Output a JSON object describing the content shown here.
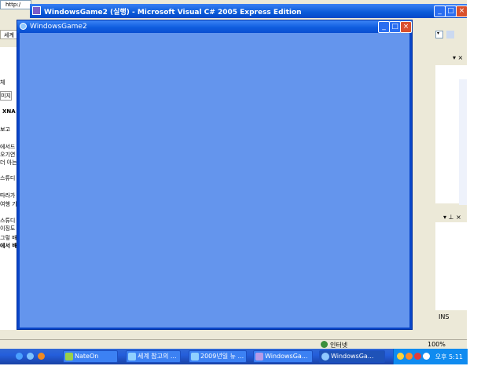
{
  "ie": {
    "address_label": "http:/",
    "tab_label": "세계",
    "left_texts": [
      "체",
      "미지",
      "XNA",
      "보고",
      "에서드",
      "오기연",
      "더 아는",
      "스튜디",
      "따라가",
      "여행 기",
      "스튜디",
      "이징도",
      "그렇 배",
      "에서 배"
    ],
    "status_zone": "인터넷",
    "zoom": "100%"
  },
  "vs": {
    "title": "WindowsGame2 (실행) - Microsoft Visual C# 2005 Express Edition",
    "status_ins": "INS"
  },
  "game": {
    "title": "WindowsGame2",
    "canvas_color": "#6495ED"
  },
  "taskbar": {
    "buttons": [
      {
        "label": "NateOn"
      },
      {
        "label": "세계 참고의 ..."
      },
      {
        "label": "2009년일 뉴 ..."
      },
      {
        "label": "WindowsGa..."
      },
      {
        "label": "WindowsGa..."
      }
    ],
    "clock": "오후 5:11"
  }
}
